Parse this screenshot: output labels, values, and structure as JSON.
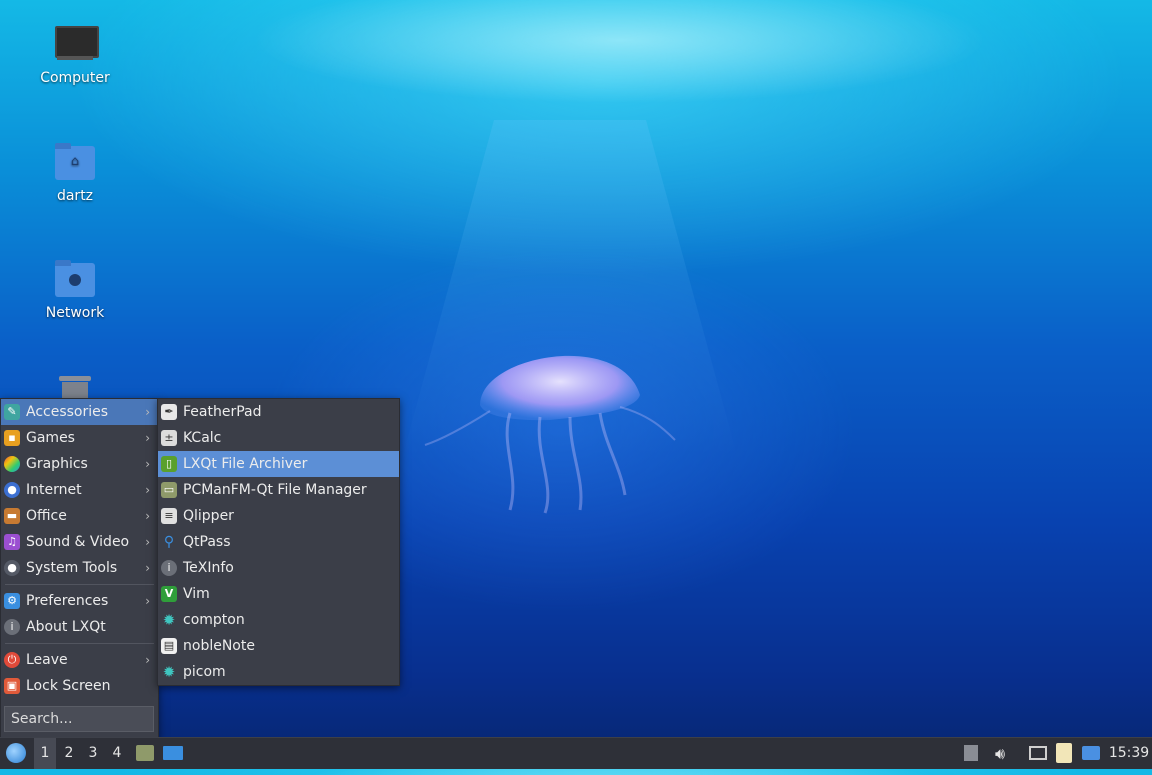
{
  "desktop": {
    "icons": [
      {
        "label": "Computer",
        "icon": "computer-icon"
      },
      {
        "label": "dartz",
        "icon": "home-folder-icon"
      },
      {
        "label": "Network",
        "icon": "network-folder-icon"
      },
      {
        "label": "",
        "icon": "trash-icon"
      }
    ]
  },
  "main_menu": {
    "items": [
      {
        "label": "Accessories",
        "icon": "accessories-icon",
        "has_submenu": true
      },
      {
        "label": "Games",
        "icon": "games-icon",
        "has_submenu": true
      },
      {
        "label": "Graphics",
        "icon": "graphics-icon",
        "has_submenu": true
      },
      {
        "label": "Internet",
        "icon": "internet-icon",
        "has_submenu": true
      },
      {
        "label": "Office",
        "icon": "office-icon",
        "has_submenu": true
      },
      {
        "label": "Sound & Video",
        "icon": "sound-video-icon",
        "has_submenu": true
      },
      {
        "label": "System Tools",
        "icon": "system-tools-icon",
        "has_submenu": true
      },
      {
        "label": "Preferences",
        "icon": "preferences-icon",
        "has_submenu": true
      },
      {
        "label": "About LXQt",
        "icon": "info-icon",
        "has_submenu": false
      },
      {
        "label": "Leave",
        "icon": "power-icon",
        "has_submenu": true
      },
      {
        "label": "Lock Screen",
        "icon": "lock-icon",
        "has_submenu": false
      }
    ],
    "search_placeholder": "Search...",
    "arrow": "›"
  },
  "accessories_menu": {
    "items": [
      {
        "label": "FeatherPad",
        "icon": "featherpad-icon"
      },
      {
        "label": "KCalc",
        "icon": "kcalc-icon"
      },
      {
        "label": "LXQt File Archiver",
        "icon": "archiver-icon"
      },
      {
        "label": "PCManFM-Qt File Manager",
        "icon": "file-manager-icon"
      },
      {
        "label": "Qlipper",
        "icon": "qlipper-icon"
      },
      {
        "label": "QtPass",
        "icon": "qtpass-icon"
      },
      {
        "label": "TeXInfo",
        "icon": "texinfo-icon"
      },
      {
        "label": "Vim",
        "icon": "vim-icon"
      },
      {
        "label": "compton",
        "icon": "compton-icon"
      },
      {
        "label": "nobleNote",
        "icon": "noblenote-icon"
      },
      {
        "label": "picom",
        "icon": "picom-icon"
      }
    ],
    "highlighted": "LXQt File Archiver"
  },
  "taskbar": {
    "desktops": [
      "1",
      "2",
      "3",
      "4"
    ],
    "active_desktop": "1",
    "clock": "15:39"
  },
  "colors": {
    "menu_bg": "#3b3e48",
    "highlight": "#5c8fd6",
    "taskbar_bg": "#2e3038"
  }
}
